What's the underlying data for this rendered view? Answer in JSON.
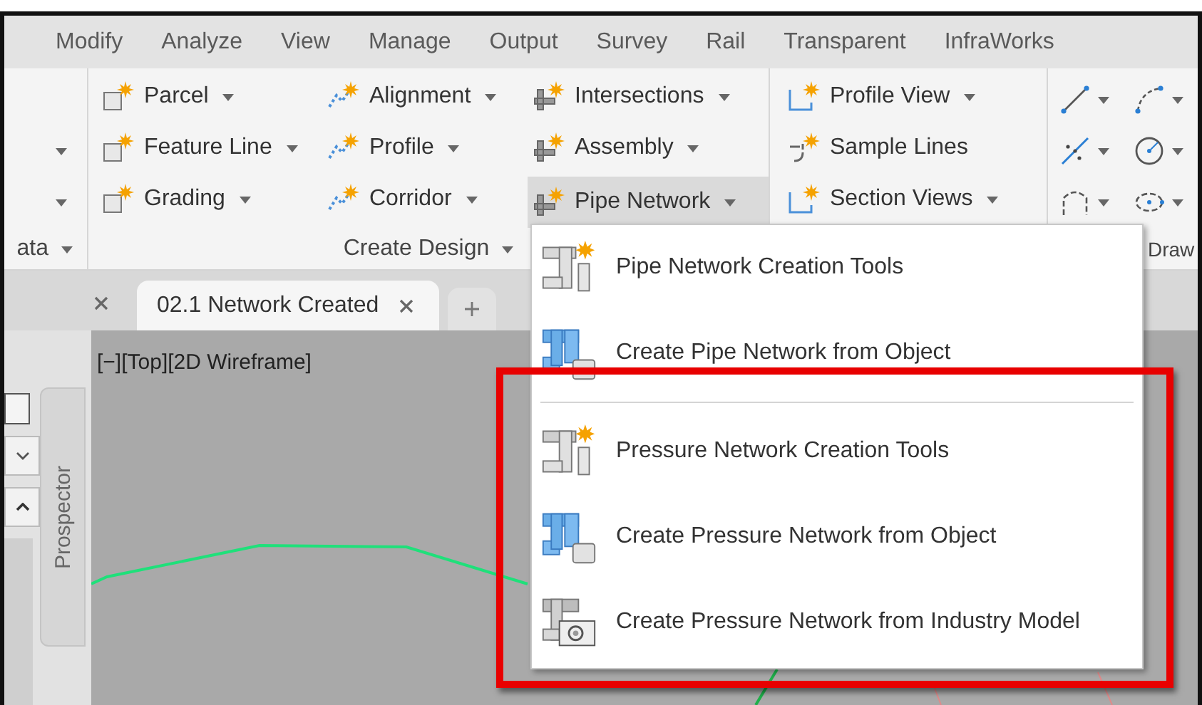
{
  "ribbon_tabs": [
    "Modify",
    "Analyze",
    "View",
    "Manage",
    "Output",
    "Survey",
    "Rail",
    "Transparent",
    "InfraWorks"
  ],
  "left_panel": {
    "label": "ata"
  },
  "create_design_panel": {
    "label": "Create Design",
    "columns": [
      [
        {
          "label": "Parcel",
          "dropdown": true,
          "selected": false
        },
        {
          "label": "Feature Line",
          "dropdown": true,
          "selected": false
        },
        {
          "label": "Grading",
          "dropdown": true,
          "selected": false
        }
      ],
      [
        {
          "label": "Alignment",
          "dropdown": true,
          "selected": false
        },
        {
          "label": "Profile",
          "dropdown": true,
          "selected": false
        },
        {
          "label": "Corridor",
          "dropdown": true,
          "selected": false
        }
      ],
      [
        {
          "label": "Intersections",
          "dropdown": true,
          "selected": false
        },
        {
          "label": "Assembly",
          "dropdown": true,
          "selected": false
        },
        {
          "label": "Pipe Network",
          "dropdown": true,
          "selected": true
        }
      ]
    ]
  },
  "profile_section_panel": {
    "tools": [
      {
        "label": "Profile View",
        "dropdown": true
      },
      {
        "label": "Sample Lines",
        "dropdown": false
      },
      {
        "label": "Section Views",
        "dropdown": true
      }
    ]
  },
  "draw_panel": {
    "label": "Draw"
  },
  "document_tabs": [
    {
      "label": "02.1 Network Created",
      "selected": true
    }
  ],
  "viewport": {
    "label": "[−][Top][2D Wireframe]"
  },
  "palette": {
    "tab": "Prospector"
  },
  "dropdown_menu": {
    "sections": [
      {
        "highlighted": false,
        "items": [
          {
            "label": "Pipe Network Creation Tools",
            "kind": "creation_tools"
          },
          {
            "label": "Create Pipe Network from Object",
            "kind": "from_object"
          }
        ]
      },
      {
        "highlighted": true,
        "items": [
          {
            "label": "Pressure Network Creation Tools",
            "kind": "creation_tools"
          },
          {
            "label": "Create Pressure Network from Object",
            "kind": "from_object"
          },
          {
            "label": "Create Pressure Network from Industry Model",
            "kind": "from_industry_model"
          }
        ]
      }
    ]
  }
}
